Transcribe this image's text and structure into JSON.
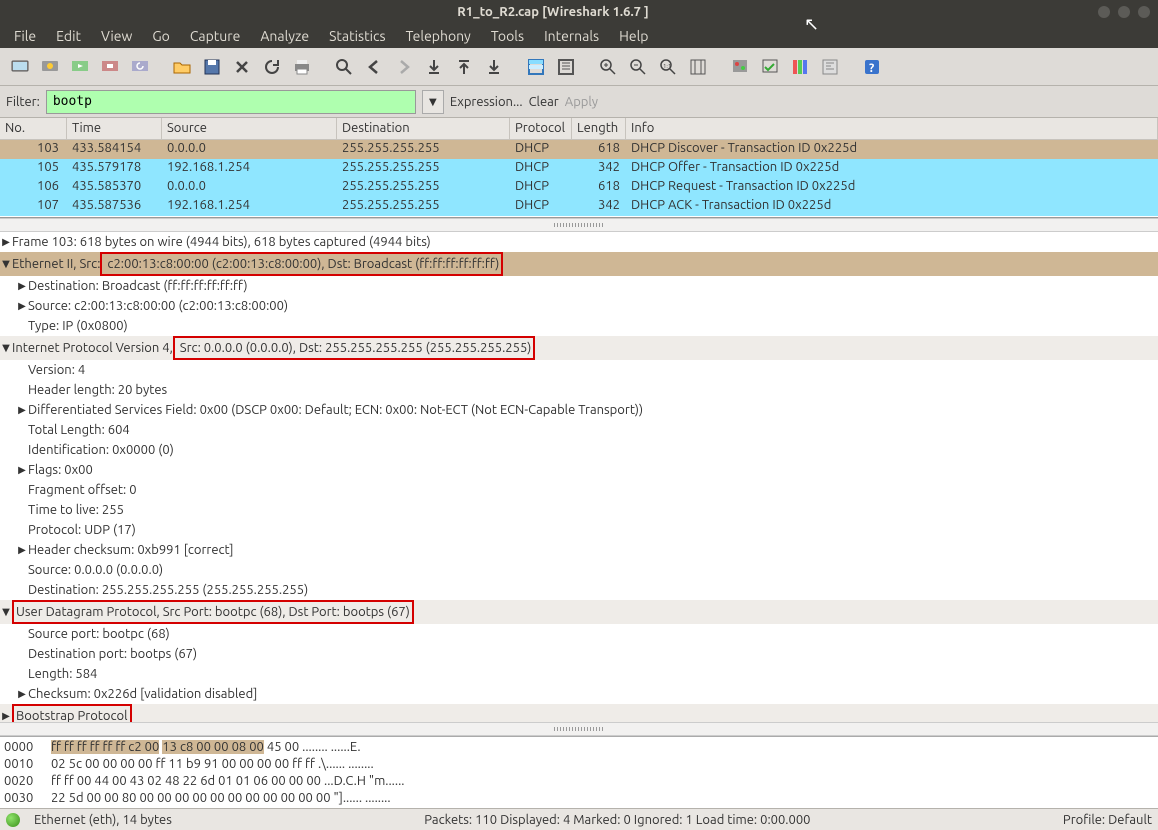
{
  "title": "R1_to_R2.cap   [Wireshark 1.6.7 ]",
  "menu": [
    "File",
    "Edit",
    "View",
    "Go",
    "Capture",
    "Analyze",
    "Statistics",
    "Telephony",
    "Tools",
    "Internals",
    "Help"
  ],
  "filter": {
    "label": "Filter:",
    "value": "bootp",
    "expression": "Expression...",
    "clear": "Clear",
    "apply": "Apply"
  },
  "columns": {
    "no": "No.",
    "time": "Time",
    "src": "Source",
    "dst": "Destination",
    "proto": "Protocol",
    "len": "Length",
    "info": "Info"
  },
  "packets": [
    {
      "no": "103",
      "time": "433.584154",
      "src": "0.0.0.0",
      "dst": "255.255.255.255",
      "proto": "DHCP",
      "len": "618",
      "info": "DHCP Discover - Transaction ID 0x225d",
      "sel": true
    },
    {
      "no": "105",
      "time": "435.579178",
      "src": "192.168.1.254",
      "dst": "255.255.255.255",
      "proto": "DHCP",
      "len": "342",
      "info": "DHCP Offer    - Transaction ID 0x225d"
    },
    {
      "no": "106",
      "time": "435.585370",
      "src": "0.0.0.0",
      "dst": "255.255.255.255",
      "proto": "DHCP",
      "len": "618",
      "info": "DHCP Request  - Transaction ID 0x225d"
    },
    {
      "no": "107",
      "time": "435.587536",
      "src": "192.168.1.254",
      "dst": "255.255.255.255",
      "proto": "DHCP",
      "len": "342",
      "info": "DHCP ACK      - Transaction ID 0x225d"
    }
  ],
  "tree": {
    "frame": "Frame 103: 618 bytes on wire (4944 bits), 618 bytes captured (4944 bits)",
    "eth_pre": "Ethernet II, Src:",
    "eth_box": " c2:00:13:c8:00:00 (c2:00:13:c8:00:00), Dst: Broadcast (ff:ff:ff:ff:ff:ff)",
    "eth_dst": "Destination: Broadcast (ff:ff:ff:ff:ff:ff)",
    "eth_src": "Source: c2:00:13:c8:00:00 (c2:00:13:c8:00:00)",
    "eth_type": "Type: IP (0x0800)",
    "ip_pre": "Internet Protocol Version 4,",
    "ip_box": " Src: 0.0.0.0 (0.0.0.0), Dst: 255.255.255.255 (255.255.255.255)",
    "ip_ver": "Version: 4",
    "ip_hlen": "Header length: 20 bytes",
    "ip_dsf": "Differentiated Services Field: 0x00 (DSCP 0x00: Default; ECN: 0x00: Not-ECT (Not ECN-Capable Transport))",
    "ip_tlen": "Total Length: 604",
    "ip_id": "Identification: 0x0000 (0)",
    "ip_flags": "Flags: 0x00",
    "ip_frag": "Fragment offset: 0",
    "ip_ttl": "Time to live: 255",
    "ip_proto": "Protocol: UDP (17)",
    "ip_chk": "Header checksum: 0xb991 [correct]",
    "ip_srcaddr": "Source: 0.0.0.0 (0.0.0.0)",
    "ip_dstaddr": "Destination: 255.255.255.255 (255.255.255.255)",
    "udp_box": "User Datagram Protocol, Src Port: bootpc (68), Dst Port: bootps (67)",
    "udp_sp": "Source port: bootpc (68)",
    "udp_dp": "Destination port: bootps (67)",
    "udp_len": "Length: 584",
    "udp_chk": "Checksum: 0x226d [validation disabled]",
    "bootp": "Bootstrap Protocol"
  },
  "hex": {
    "l0_off": "0000",
    "l0_a": "ff ff ff ff ff ff c2 00",
    "l0_b": "13 c8 00 00 08 00",
    "l0_c": " 45 00",
    "l0_asc": "   ........ ......E.",
    "l1_off": "0010",
    "l1": "  02 5c 00 00 00 00 ff 11  b9 91 00 00 00 00 ff ff    .\\...... ........",
    "l2_off": "0020",
    "l2": "  ff ff 00 44 00 43 02 48  22 6d 01 01 06 00 00 00    ...D.C.H \"m......",
    "l3_off": "0030",
    "l3": "  22 5d 00 00 80 00 00 00  00 00 00 00 00 00 00 00    \"]...... ........"
  },
  "status": {
    "left": "Ethernet (eth), 14 bytes",
    "mid": "Packets: 110 Displayed: 4 Marked: 0 Ignored: 1 Load time: 0:00.000",
    "right": "Profile: Default"
  }
}
